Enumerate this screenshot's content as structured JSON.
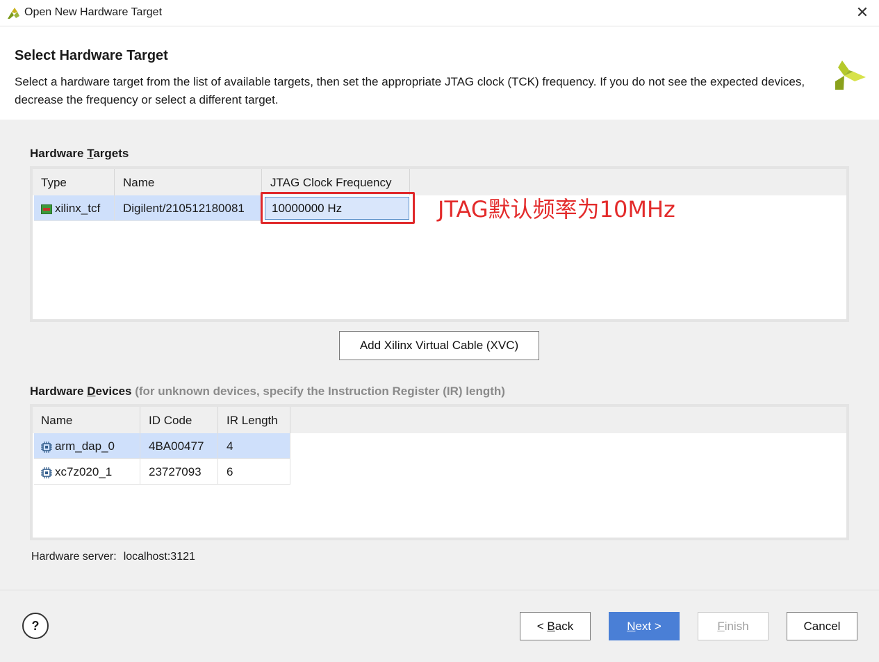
{
  "window": {
    "title": "Open New Hardware Target",
    "close_glyph": "✕"
  },
  "header": {
    "title": "Select Hardware Target",
    "description": "Select a hardware target from the list of available targets, then set the appropriate JTAG clock (TCK) frequency. If you do not see the expected devices, decrease the frequency or select a different target."
  },
  "targets": {
    "label_pre": "Hardware ",
    "label_u": "T",
    "label_post": "argets",
    "columns": [
      "Type",
      "Name",
      "JTAG Clock Frequency"
    ],
    "rows": [
      {
        "type": "xilinx_tcf",
        "name": "Digilent/210512180081",
        "frequency": "10000000 Hz"
      }
    ],
    "add_xvc_button": "Add Xilinx Virtual Cable (XVC)"
  },
  "annotation": {
    "text": "JTAG默认频率为10MHz",
    "color": "#e32b2b"
  },
  "devices": {
    "label_pre": "Hardware ",
    "label_u": "D",
    "label_post": "evices",
    "note": "(for unknown devices, specify the Instruction Register (IR) length)",
    "columns": [
      "Name",
      "ID Code",
      "IR Length"
    ],
    "rows": [
      {
        "name": "arm_dap_0",
        "id_code": "4BA00477",
        "ir_length": "4"
      },
      {
        "name": "xc7z020_1",
        "id_code": "23727093",
        "ir_length": "6"
      }
    ]
  },
  "server": {
    "label": "Hardware server:",
    "value": "localhost:3121"
  },
  "footer": {
    "help": "?",
    "back_pre": "< ",
    "back_u": "B",
    "back_post": "ack",
    "next_u": "N",
    "next_post": "ext >",
    "finish_u": "F",
    "finish_post": "inish",
    "cancel": "Cancel"
  },
  "colors": {
    "accent": "#4a7fd6",
    "selection": "#cfe0fb",
    "highlight_box": "#e0282a"
  }
}
